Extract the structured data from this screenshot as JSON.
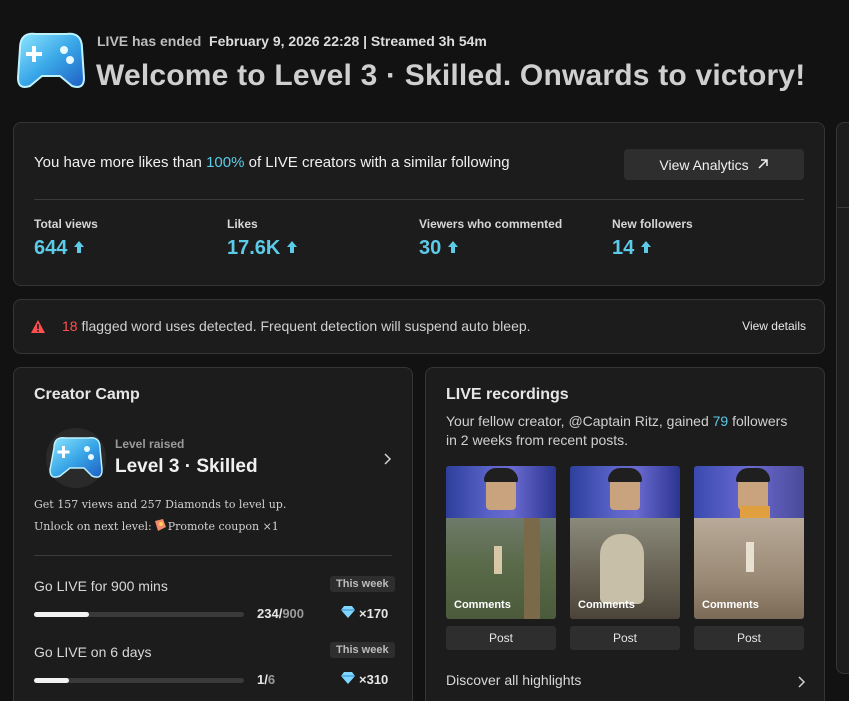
{
  "header": {
    "status": "LIVE has ended",
    "meta": "February 9, 2026 22:28 | Streamed 3h 54m",
    "title": "Welcome to Level 3 · Skilled. Onwards to victory!"
  },
  "summary": {
    "banner_prefix": "You have more likes than",
    "banner_percent": "100%",
    "banner_suffix": "of LIVE creators with a similar following",
    "analytics_button": "View Analytics",
    "stats": [
      {
        "label": "Total views",
        "value": "644"
      },
      {
        "label": "Likes",
        "value": "17.6K"
      },
      {
        "label": "Viewers who commented",
        "value": "30"
      },
      {
        "label": "New followers",
        "value": "14"
      }
    ]
  },
  "alert": {
    "count": "18",
    "message": "flagged word uses detected. Frequent detection will suspend auto bleep.",
    "link": "View details"
  },
  "creator_camp": {
    "title": "Creator Camp",
    "level_caption": "Level raised",
    "level_name": "Level 3 · Skilled",
    "requirement": "Get 157 views and 257 Diamonds to level up.",
    "unlock_prefix": "Unlock on next level:",
    "unlock_item": "Promote coupon ×1",
    "tasks": [
      {
        "label": "Go LIVE for 900 mins",
        "badge": "This week",
        "current": "234",
        "total": "900",
        "progress": 0.26,
        "reward": "×170"
      },
      {
        "label": "Go LIVE on 6 days",
        "badge": "This week",
        "current": "1",
        "total": "6",
        "progress": 0.167,
        "reward": "×310"
      }
    ]
  },
  "recordings": {
    "title": "LIVE recordings",
    "desc_prefix": "Your fellow creator, @Captain Ritz, gained",
    "desc_count": "79",
    "desc_suffix": "followers",
    "desc_line2": "in 2 weeks from recent posts.",
    "clips": [
      {
        "label": "Comments",
        "button": "Post"
      },
      {
        "label": "Comments",
        "button": "Post"
      },
      {
        "label": "Comments",
        "button": "Post"
      }
    ],
    "discover": "Discover all highlights"
  },
  "colors": {
    "accent": "#5ccbe8",
    "alert": "#ff5050"
  }
}
